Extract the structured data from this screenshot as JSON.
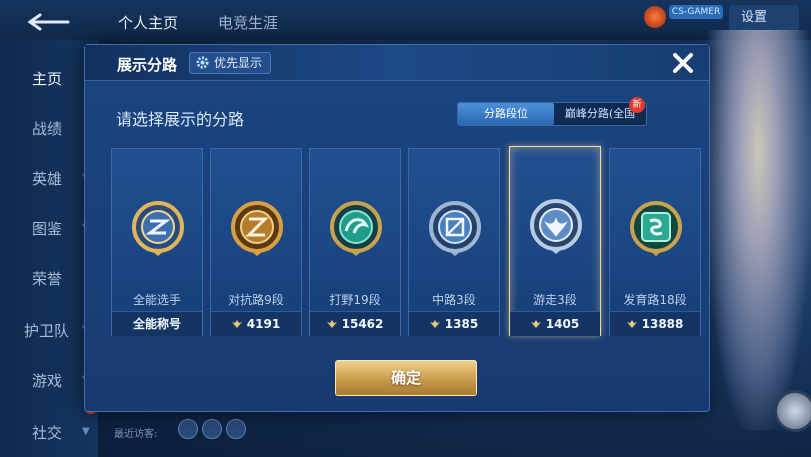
{
  "topbar": {
    "tabs": [
      "个人主页",
      "电竞生涯"
    ],
    "id_chip": "CS-GAMER",
    "settings_label": "设置"
  },
  "sidebar": {
    "items": [
      {
        "label": "主页",
        "active": true
      },
      {
        "label": "战绩"
      },
      {
        "label": "英雄"
      },
      {
        "label": "图鉴"
      },
      {
        "label": "荣誉"
      },
      {
        "label": "护卫队"
      },
      {
        "label": "游戏"
      },
      {
        "label": "社交"
      }
    ]
  },
  "recent_visitors_label": "最近访客:",
  "modal": {
    "title": "展示分路",
    "priority_label": "优先显示",
    "subtitle": "请选择展示的分路",
    "tabs": [
      "分路段位",
      "巅峰分路(全国"
    ],
    "active_tab": 0,
    "new_badge": "新",
    "confirm_label": "确定"
  },
  "cards": [
    {
      "name": "全能选手",
      "score": "全能称号",
      "emblem": "allround-emblem-icon",
      "color": "#d8a84a"
    },
    {
      "name": "对抗路9段",
      "score": "4191",
      "emblem": "clash-lane-emblem-icon",
      "color": "#c9903a"
    },
    {
      "name": "打野19段",
      "score": "15462",
      "emblem": "jungle-emblem-icon",
      "color": "#2fae9c"
    },
    {
      "name": "中路3段",
      "score": "1385",
      "emblem": "mid-lane-emblem-icon",
      "color": "#7fa6cf"
    },
    {
      "name": "游走3段",
      "score": "1405",
      "emblem": "roam-emblem-icon",
      "color": "#8fb2d8",
      "selected": true
    },
    {
      "name": "发育路18段",
      "score": "13888",
      "emblem": "farm-lane-emblem-icon",
      "color": "#35b6a0"
    }
  ]
}
